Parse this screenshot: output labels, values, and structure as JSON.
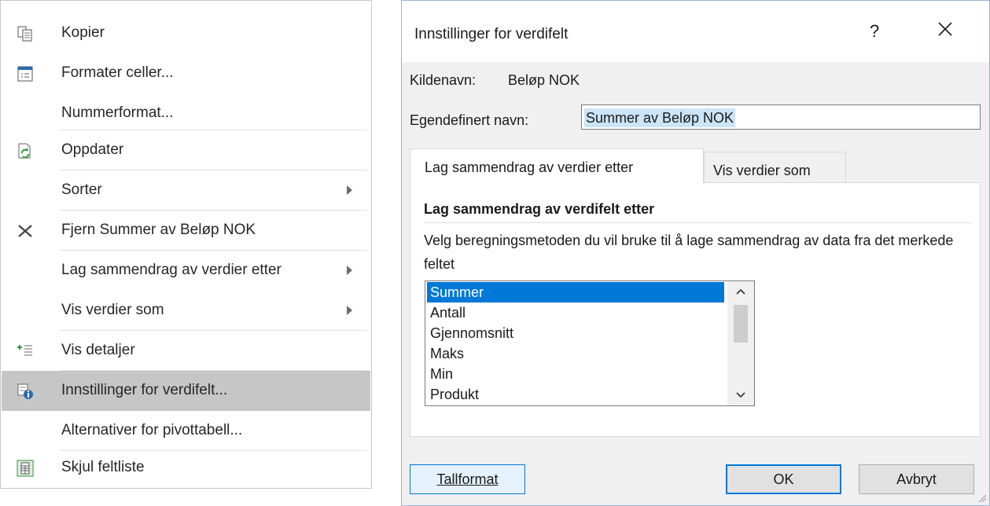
{
  "context_menu": {
    "items": [
      {
        "label": "Kopier",
        "icon": "copy-icon",
        "has_submenu": false,
        "highlighted": false
      },
      {
        "label": "Formater celler...",
        "icon": "format-cells-icon",
        "has_submenu": false,
        "highlighted": false
      },
      {
        "label": "Nummerformat...",
        "icon": "",
        "has_submenu": false,
        "highlighted": false
      },
      {
        "label": "Oppdater",
        "icon": "refresh-icon",
        "has_submenu": false,
        "highlighted": false
      },
      {
        "label": "Sorter",
        "icon": "",
        "has_submenu": true,
        "highlighted": false
      },
      {
        "label": "Fjern Summer av Beløp NOK",
        "icon": "remove-icon",
        "has_submenu": false,
        "highlighted": false
      },
      {
        "label": "Lag sammendrag av verdier etter",
        "icon": "",
        "has_submenu": true,
        "highlighted": false
      },
      {
        "label": "Vis verdier som",
        "icon": "",
        "has_submenu": true,
        "highlighted": false
      },
      {
        "label": "Vis detaljer",
        "icon": "show-details-icon",
        "has_submenu": false,
        "highlighted": false
      },
      {
        "label": "Innstillinger for verdifelt...",
        "icon": "field-settings-icon",
        "has_submenu": false,
        "highlighted": true
      },
      {
        "label": "Alternativer for pivottabell...",
        "icon": "",
        "has_submenu": false,
        "highlighted": false
      },
      {
        "label": "Skjul feltliste",
        "icon": "field-list-icon",
        "has_submenu": false,
        "highlighted": false
      }
    ]
  },
  "dialog": {
    "title": "Innstillinger for verdifelt",
    "help_label": "?",
    "source_name_label": "Kildenavn:",
    "source_name_value": "Beløp NOK",
    "custom_name_label": "Egendefinert navn:",
    "custom_name_value": "Summer av Beløp NOK",
    "tabs": [
      {
        "label": "Lag sammendrag av verdier etter",
        "active": true
      },
      {
        "label": "Vis verdier som",
        "active": false
      }
    ],
    "group_title": "Lag sammendrag av verdifelt etter",
    "description": "Velg beregningsmetoden du vil bruke til å lage sammendrag av data fra det merkede feltet",
    "functions": [
      "Summer",
      "Antall",
      "Gjennomsnitt",
      "Maks",
      "Min",
      "Produkt"
    ],
    "selected_function": "Summer",
    "buttons": {
      "number_format": "Tallformat",
      "ok": "OK",
      "cancel": "Avbryt"
    }
  },
  "colors": {
    "selection": "#0078d7",
    "menu_highlight": "#c6c6c6",
    "dialog_bg": "#f0f0f0"
  }
}
